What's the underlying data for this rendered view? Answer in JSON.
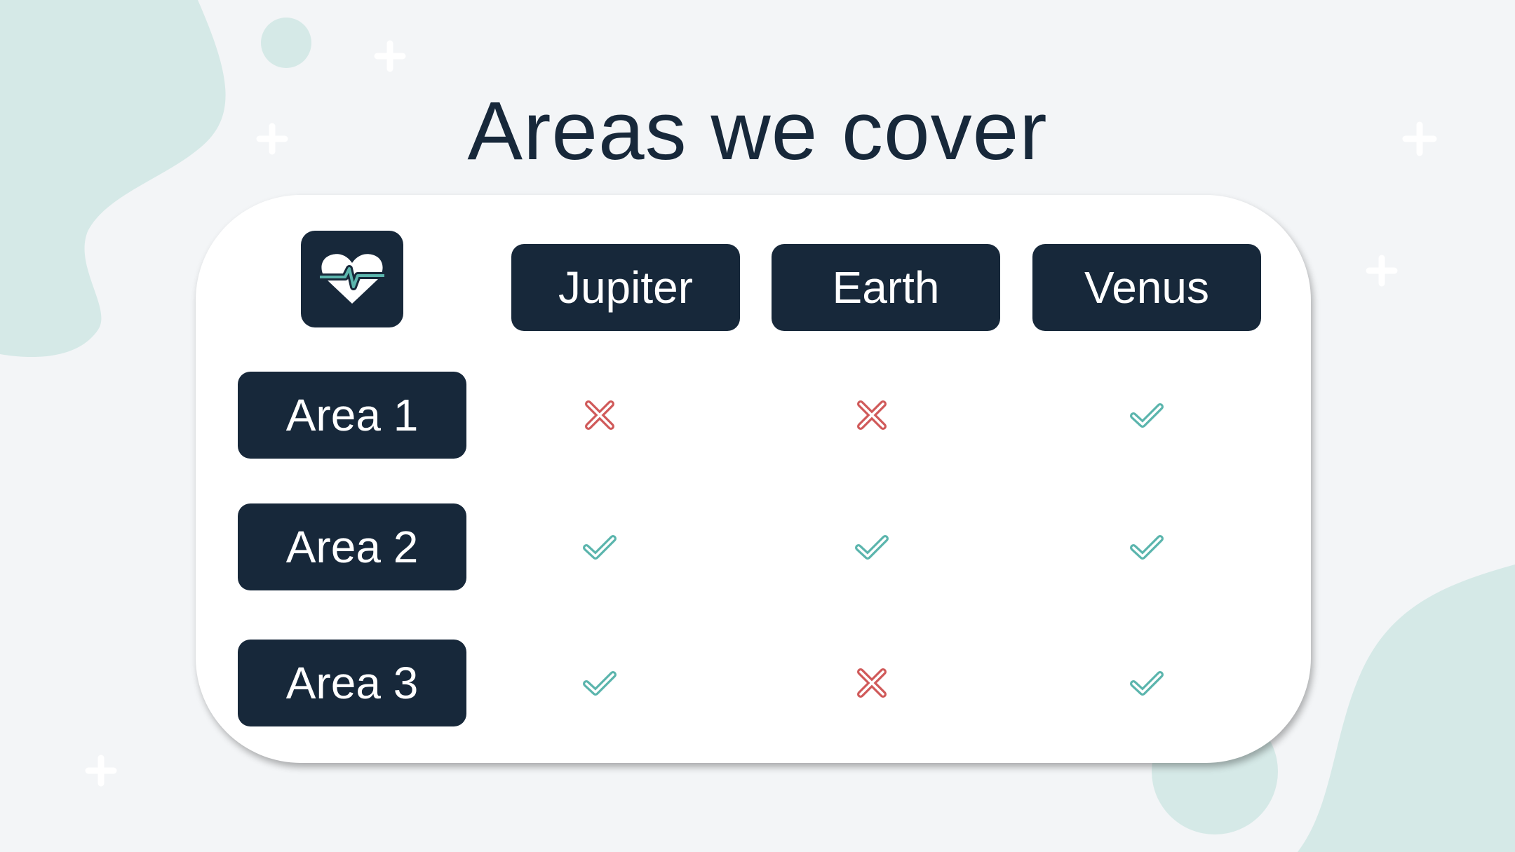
{
  "slide": {
    "title": "Areas we cover",
    "logo_icon": "heart-pulse-icon",
    "columns": [
      "Jupiter",
      "Earth",
      "Venus"
    ],
    "rows": [
      {
        "label": "Area 1",
        "cells": [
          "cross",
          "cross",
          "check"
        ]
      },
      {
        "label": "Area 2",
        "cells": [
          "check",
          "check",
          "check"
        ]
      },
      {
        "label": "Area 3",
        "cells": [
          "check",
          "cross",
          "check"
        ]
      }
    ]
  },
  "colors": {
    "dark": "#17283a",
    "teal": "#5bb5ad",
    "red": "#d05a5a",
    "blob": "#d5e9e7",
    "background": "#f3f5f7"
  }
}
